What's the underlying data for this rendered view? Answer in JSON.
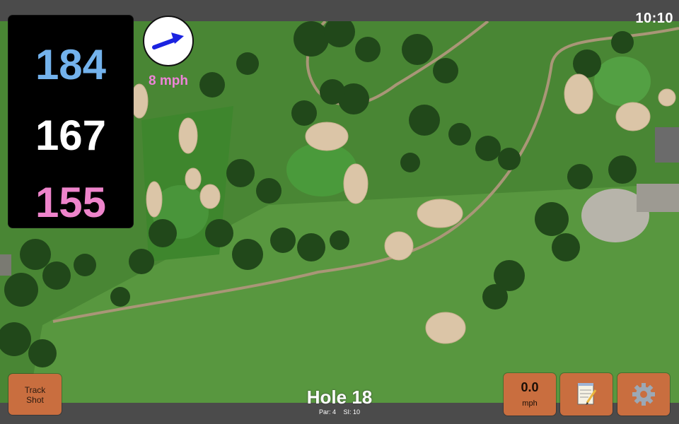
{
  "status_bar": {
    "time": "10:10"
  },
  "distances": {
    "back": "184",
    "middle": "167",
    "front": "155"
  },
  "wind": {
    "speed_label": "8 mph",
    "icon": "arrow-right-icon"
  },
  "hole": {
    "title": "Hole 18",
    "par_label": "Par: 4",
    "si_label": "SI: 10"
  },
  "buttons": {
    "track_shot_line1": "Track",
    "track_shot_line2": "Shot",
    "speed_value": "0.0",
    "speed_unit": "mph",
    "notes_icon": "notepad-icon",
    "settings_icon": "gear-icon"
  },
  "colors": {
    "back_distance": "#73b2ec",
    "middle_distance": "#ffffff",
    "front_distance": "#ee84cb",
    "button_bg": "#c96e3f",
    "wind_label": "#ee84d8"
  }
}
